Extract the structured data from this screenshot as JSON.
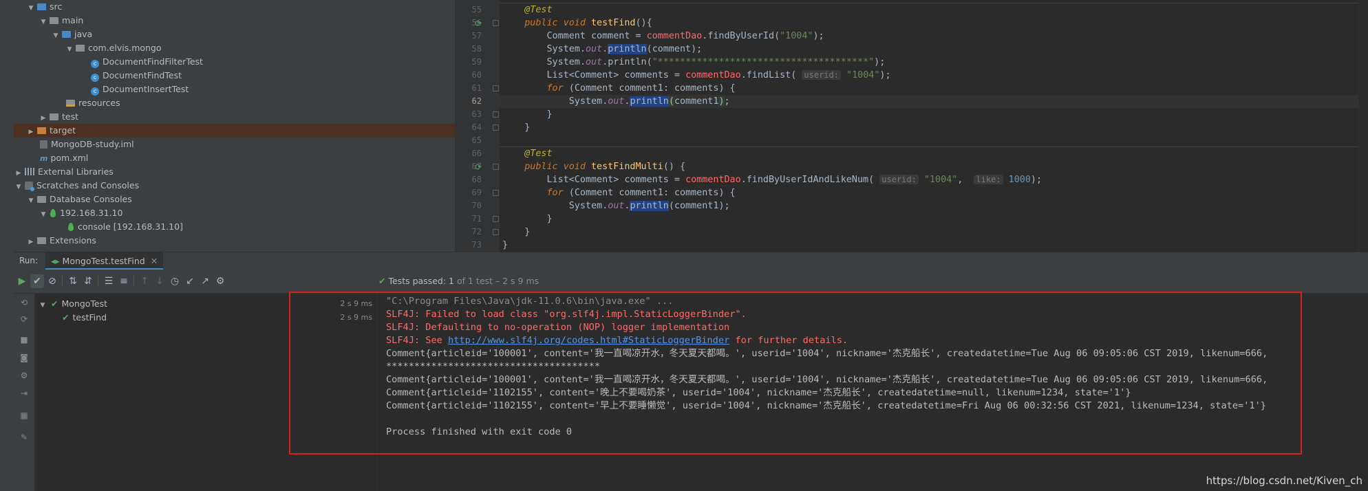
{
  "project_tree": {
    "items": [
      {
        "label": "src"
      },
      {
        "label": "main"
      },
      {
        "label": "java"
      },
      {
        "label": "com.elvis.mongo"
      },
      {
        "label": "DocumentFindFilterTest"
      },
      {
        "label": "DocumentFindTest"
      },
      {
        "label": "DocumentInsertTest"
      },
      {
        "label": "resources"
      },
      {
        "label": "test"
      },
      {
        "label": "target"
      },
      {
        "label": "MongoDB-study.iml"
      },
      {
        "label": "pom.xml"
      },
      {
        "label": "External Libraries"
      },
      {
        "label": "Scratches and Consoles"
      },
      {
        "label": "Database Consoles"
      },
      {
        "label": "192.168.31.10"
      },
      {
        "label": "console [192.168.31.10]"
      },
      {
        "label": "Extensions"
      }
    ]
  },
  "editor": {
    "line_numbers": [
      "55",
      "56",
      "57",
      "58",
      "59",
      "60",
      "61",
      "62",
      "63",
      "64",
      "65",
      "66",
      "67",
      "68",
      "69",
      "70",
      "71",
      "72",
      "73"
    ],
    "code": {
      "ann_test": "@Test",
      "kw_public": "public",
      "kw_void": "void",
      "kw_for": "for",
      "fn_testFind": "testFind",
      "fn_testFindMulti": "testFindMulti",
      "comment_type": "Comment",
      "list_type": "List<Comment>",
      "var_comment": "comment",
      "var_comments": "comments",
      "var_comment1": "comment1",
      "dao": "commentDao",
      "m_findByUserId": "findByUserId",
      "m_findList": "findList",
      "m_findByUserIdAndLikeNum": "findByUserIdAndLikeNum",
      "system": "System",
      "out": "out",
      "println": "println",
      "str_1004": "\"1004\"",
      "str_stars": "\"**************************************\"",
      "hint_userid": "userid:",
      "hint_like": "like:",
      "num_1000": "1000"
    }
  },
  "run_panel": {
    "label": "Run:",
    "tab_label": "MongoTest.testFind",
    "status": {
      "prefix": "Tests passed:",
      "count": "1",
      "suffix": "of 1 test – 2 s 9 ms"
    },
    "tree": [
      {
        "label": "MongoTest",
        "time": "2 s 9 ms"
      },
      {
        "label": "testFind",
        "time": "2 s 9 ms"
      }
    ]
  },
  "console": {
    "lines": [
      "\"C:\\Program Files\\Java\\jdk-11.0.6\\bin\\java.exe\" ...",
      "SLF4J: Failed to load class \"org.slf4j.impl.StaticLoggerBinder\".",
      "SLF4J: Defaulting to no-operation (NOP) logger implementation",
      "Comment{articleid='100001', content='我一直喝凉开水，冬天夏天都喝。', userid='1004', nickname='杰克船长', createdatetime=Tue Aug 06 09:05:06 CST 2019, likenum=666,",
      "**************************************",
      "Comment{articleid='100001', content='我一直喝凉开水，冬天夏天都喝。', userid='1004', nickname='杰克船长', createdatetime=Tue Aug 06 09:05:06 CST 2019, likenum=666,",
      "Comment{articleid='1102155', content='晚上不要喝奶茶', userid='1004', nickname='杰克船长', createdatetime=null, likenum=1234, state='1'}",
      "Comment{articleid='1102155', content='早上不要睡懒觉', userid='1004', nickname='杰克船长', createdatetime=Fri Aug 06 00:32:56 CST 2021, likenum=1234, state='1'}",
      "Process finished with exit code 0"
    ],
    "slf4j_see": {
      "prefix": "SLF4J: See ",
      "link": "http://www.slf4j.org/codes.html#StaticLoggerBinder",
      "suffix": " for further details."
    }
  },
  "watermark": "https://blog.csdn.net/Kiven_ch",
  "colors": {
    "highlight_box": "#e0201c",
    "pass_green": "#5ea45e",
    "error_red": "#ff6b68"
  }
}
